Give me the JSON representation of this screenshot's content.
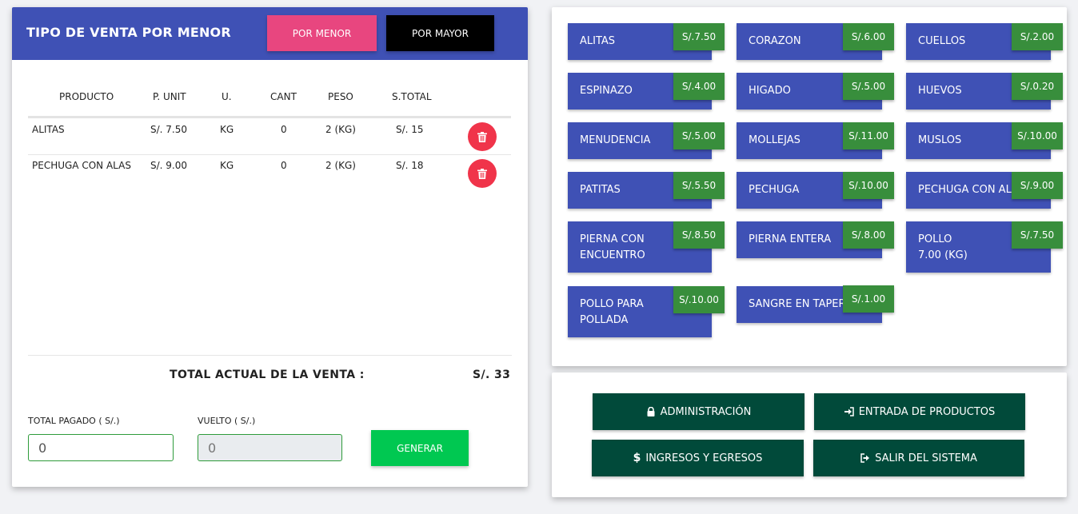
{
  "left": {
    "title": "TIPO DE VENTA POR MENOR",
    "btn_menor": "POR MENOR",
    "btn_mayor": "POR MAYOR",
    "columns": [
      "PRODUCTO",
      "P. UNIT",
      "U.",
      "CANT",
      "PESO",
      "S.TOTAL"
    ],
    "rows": [
      {
        "producto": "ALITAS",
        "punit": "S/. 7.50",
        "u": "KG",
        "cant": "0",
        "peso": "2 (KG)",
        "stotal": "S/. 15"
      },
      {
        "producto": "PECHUGA CON ALAS",
        "punit": "S/. 9.00",
        "u": "KG",
        "cant": "0",
        "peso": "2 (KG)",
        "stotal": "S/. 18"
      }
    ],
    "total_label": "TOTAL ACTUAL DE LA VENTA :",
    "total_value": "S/. 33",
    "total_pagado_label": "TOTAL PAGADO ( S/.)",
    "total_pagado_value": "0",
    "vuelto_label": "VUELTO ( S/.)",
    "vuelto_value": "0",
    "generar": "GENERAR"
  },
  "products": [
    {
      "name": "ALITAS",
      "price": "S/.7.50"
    },
    {
      "name": "CORAZON",
      "price": "S/.6.00"
    },
    {
      "name": "CUELLOS",
      "price": "S/.2.00"
    },
    {
      "name": "ESPINAZO",
      "price": "S/.4.00"
    },
    {
      "name": "HIGADO",
      "price": "S/.5.00"
    },
    {
      "name": "HUEVOS",
      "price": "S/.0.20"
    },
    {
      "name": "MENUDENCIA",
      "price": "S/.5.00"
    },
    {
      "name": "MOLLEJAS",
      "price": "S/.11.00"
    },
    {
      "name": "MUSLOS",
      "price": "S/.10.00"
    },
    {
      "name": "PATITAS",
      "price": "S/.5.50"
    },
    {
      "name": "PECHUGA",
      "price": "S/.10.00"
    },
    {
      "name": "PECHUGA CON ALAS",
      "price": "S/.9.00"
    },
    {
      "name": "PIERNA CON",
      "name2": "ENCUENTRO",
      "price": "S/.8.50"
    },
    {
      "name": "PIERNA ENTERA",
      "price": "S/.8.00"
    },
    {
      "name": "POLLO",
      "name2": "7.00 (KG)",
      "price": "S/.7.50"
    },
    {
      "name": "POLLO PARA",
      "name2": "POLLADA",
      "price": "S/.10.00"
    },
    {
      "name": "SANGRE EN TAPER",
      "price": "S/.1.00"
    }
  ],
  "actions": {
    "admin": "ADMINISTRACIÓN",
    "entrada": "ENTRADA DE PRODUCTOS",
    "ingresos": "INGRESOS Y EGRESOS",
    "salir": "SALIR DEL SISTEMA",
    "dollar_symbol": "$"
  },
  "colors": {
    "header_blue": "#3f51b5",
    "pink": "#e8467f",
    "price_green": "#388e3c",
    "action_green": "#014a3a",
    "generar_green": "#00c851",
    "delete_red": "#f0344a"
  }
}
